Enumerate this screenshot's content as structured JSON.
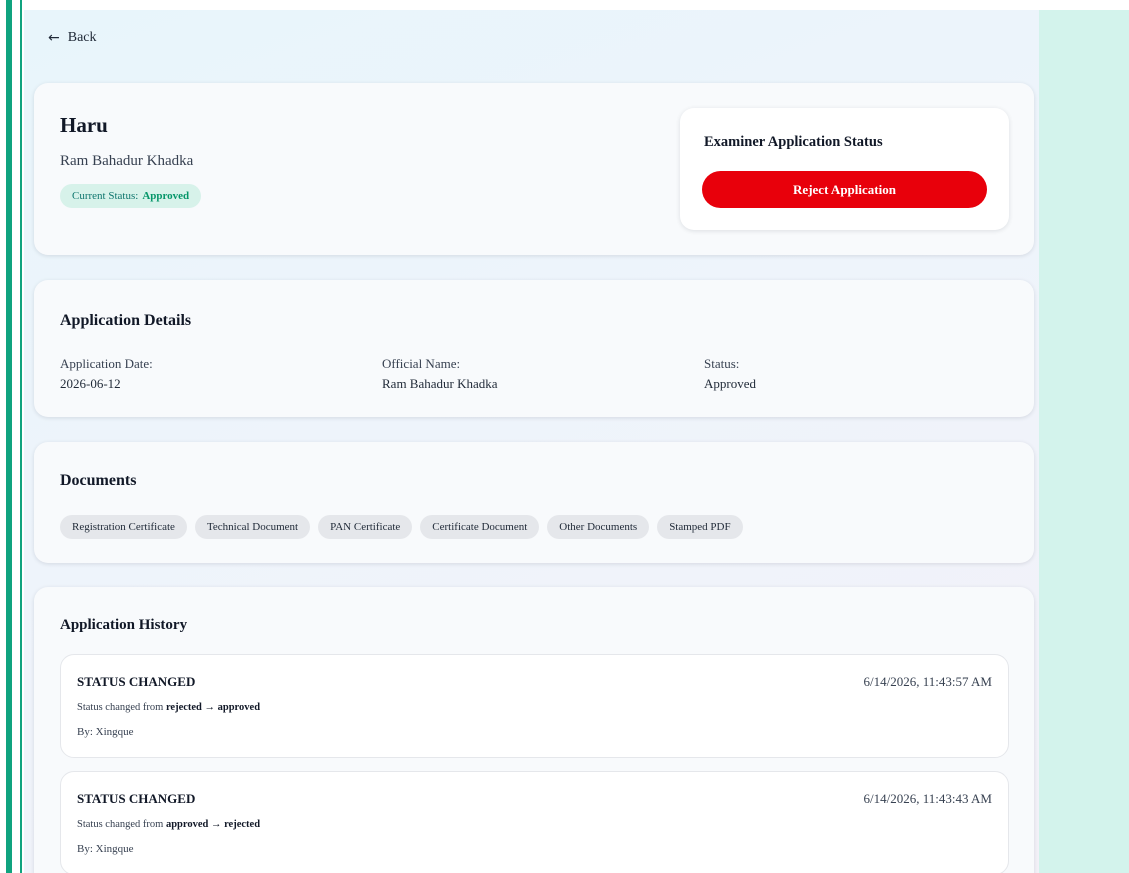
{
  "nav": {
    "back_label": "Back"
  },
  "header": {
    "title": "Haru",
    "subtitle": "Ram Bahadur Khadka",
    "status_label": "Current Status:",
    "status_value": "Approved"
  },
  "examiner": {
    "title": "Examiner Application Status",
    "reject_label": "Reject Application"
  },
  "details": {
    "title": "Application Details",
    "fields": [
      {
        "label": "Application Date:",
        "value": "2026-06-12"
      },
      {
        "label": "Official Name:",
        "value": "Ram Bahadur Khadka"
      },
      {
        "label": "Status:",
        "value": "Approved"
      }
    ]
  },
  "documents": {
    "title": "Documents",
    "items": [
      "Registration Certificate",
      "Technical Document",
      "PAN Certificate",
      "Certificate Document",
      "Other Documents",
      "Stamped PDF"
    ]
  },
  "history": {
    "title": "Application History",
    "items": [
      {
        "action": "STATUS CHANGED",
        "timestamp": "6/14/2026, 11:43:57 AM",
        "prefix": "Status changed from",
        "change": "rejected → approved",
        "by": "By: Xingque"
      },
      {
        "action": "STATUS CHANGED",
        "timestamp": "6/14/2026, 11:43:43 AM",
        "prefix": "Status changed from",
        "change": "approved → rejected",
        "by": "By: Xingque"
      }
    ]
  },
  "colors": {
    "accent_green": "#10a37f",
    "reject_red": "#e8000b",
    "approved_text": "#059669",
    "right_panel": "#d3f3ec"
  }
}
